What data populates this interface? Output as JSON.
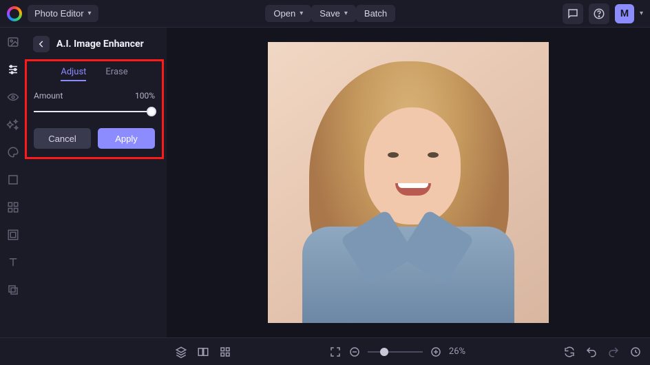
{
  "topbar": {
    "app_dropdown": "Photo Editor",
    "open": "Open",
    "save": "Save",
    "batch": "Batch",
    "avatar_initial": "M"
  },
  "panel": {
    "title": "A.I. Image Enhancer",
    "tabs": {
      "adjust": "Adjust",
      "erase": "Erase"
    },
    "amount_label": "Amount",
    "amount_value": "100%",
    "cancel": "Cancel",
    "apply": "Apply"
  },
  "bottombar": {
    "zoom_pct": "26%"
  }
}
